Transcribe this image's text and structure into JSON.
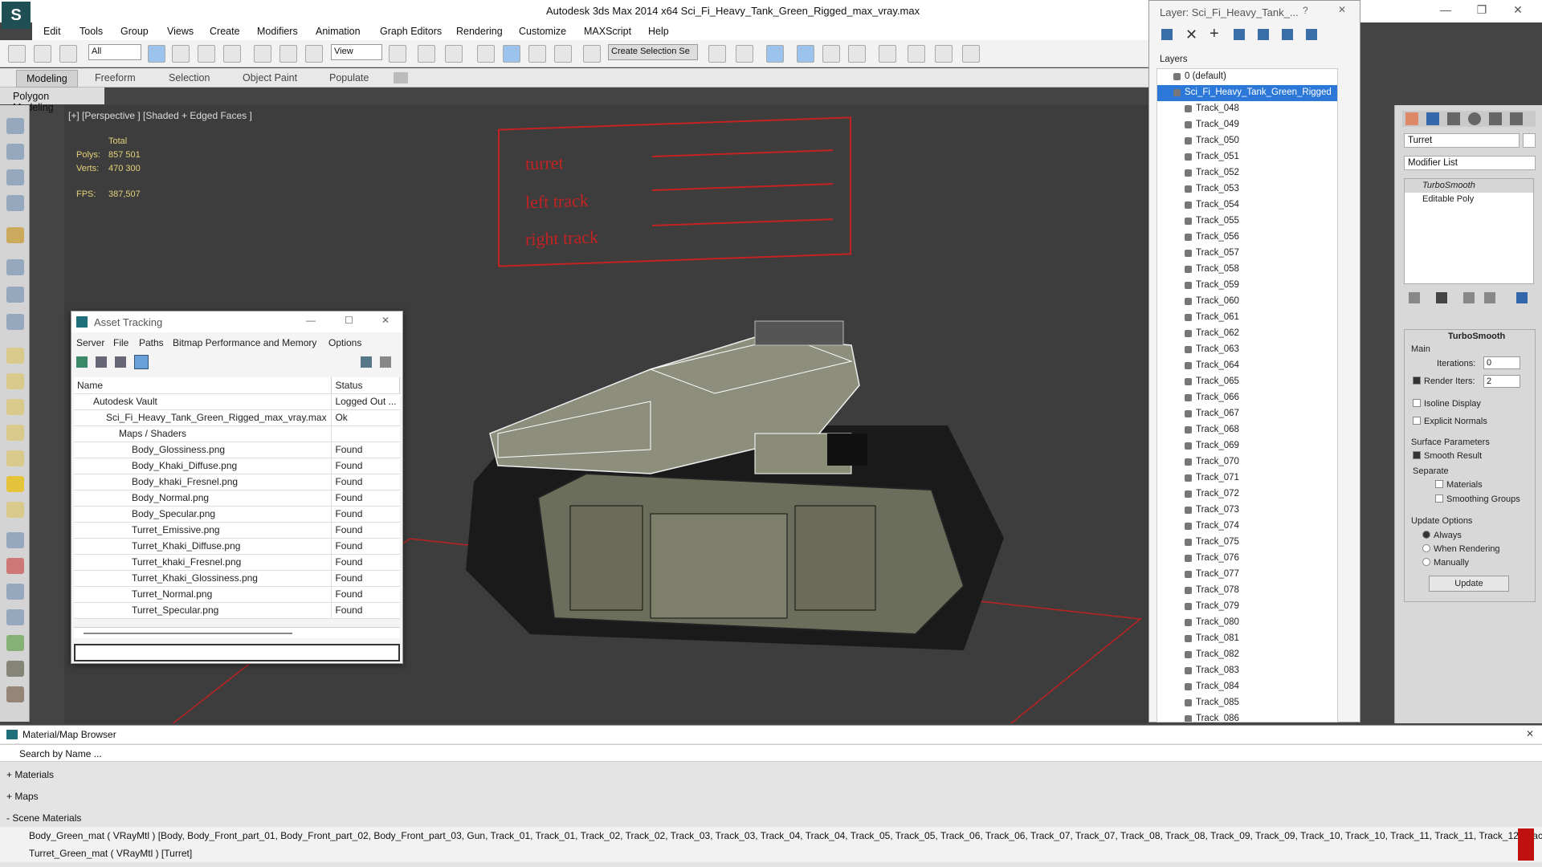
{
  "app": {
    "title": "Autodesk 3ds Max  2014 x64     Sci_Fi_Heavy_Tank_Green_Rigged_max_vray.max"
  },
  "menu": [
    "Edit",
    "Tools",
    "Group",
    "Views",
    "Create",
    "Modifiers",
    "Animation",
    "Graph Editors",
    "Rendering",
    "Customize",
    "MAXScript",
    "Help"
  ],
  "toolbar": {
    "filter": "All",
    "ref_coord": "View",
    "selection_set": "Create Selection Se"
  },
  "ribbon": {
    "tabs": [
      "Modeling",
      "Freeform",
      "Selection",
      "Object Paint",
      "Populate"
    ],
    "sub": "Polygon Modeling"
  },
  "viewport": {
    "label": "[+] [Perspective ] [Shaded + Edged Faces ]",
    "stats": {
      "total": "Total",
      "polys_label": "Polys:",
      "polys": "857 501",
      "verts_label": "Verts:",
      "verts": "470 300",
      "fps_label": "FPS:",
      "fps": "387,507"
    },
    "annotations": [
      "turret",
      "left track",
      "right track"
    ]
  },
  "asset_tracking": {
    "title": "Asset Tracking",
    "menu": [
      "Server",
      "File",
      "Paths",
      "Bitmap Performance and Memory",
      "Options"
    ],
    "columns": [
      "Name",
      "Status"
    ],
    "rows": [
      {
        "name": "Autodesk Vault",
        "status": "Logged Out ..."
      },
      {
        "name": "Sci_Fi_Heavy_Tank_Green_Rigged_max_vray.max",
        "status": "Ok"
      },
      {
        "name": "Maps / Shaders",
        "status": ""
      },
      {
        "name": "Body_Glossiness.png",
        "status": "Found"
      },
      {
        "name": "Body_Khaki_Diffuse.png",
        "status": "Found"
      },
      {
        "name": "Body_khaki_Fresnel.png",
        "status": "Found"
      },
      {
        "name": "Body_Normal.png",
        "status": "Found"
      },
      {
        "name": "Body_Specular.png",
        "status": "Found"
      },
      {
        "name": "Turret_Emissive.png",
        "status": "Found"
      },
      {
        "name": "Turret_Khaki_Diffuse.png",
        "status": "Found"
      },
      {
        "name": "Turret_khaki_Fresnel.png",
        "status": "Found"
      },
      {
        "name": "Turret_Khaki_Glossiness.png",
        "status": "Found"
      },
      {
        "name": "Turret_Normal.png",
        "status": "Found"
      },
      {
        "name": "Turret_Specular.png",
        "status": "Found"
      }
    ]
  },
  "layers": {
    "title": "Layer: Sci_Fi_Heavy_Tank_...",
    "header": "Layers",
    "items": [
      "0 (default)",
      "Sci_Fi_Heavy_Tank_Green_Rigged",
      "Track_048",
      "Track_049",
      "Track_050",
      "Track_051",
      "Track_052",
      "Track_053",
      "Track_054",
      "Track_055",
      "Track_056",
      "Track_057",
      "Track_058",
      "Track_059",
      "Track_060",
      "Track_061",
      "Track_062",
      "Track_063",
      "Track_064",
      "Track_065",
      "Track_066",
      "Track_067",
      "Track_068",
      "Track_069",
      "Track_070",
      "Track_071",
      "Track_072",
      "Track_073",
      "Track_074",
      "Track_075",
      "Track_076",
      "Track_077",
      "Track_078",
      "Track_079",
      "Track_080",
      "Track_081",
      "Track_082",
      "Track_083",
      "Track_084",
      "Track_085",
      "Track_086"
    ]
  },
  "command_panel": {
    "object_name": "Turret",
    "modifier_list": "Modifier List",
    "stack": [
      "TurboSmooth",
      "Editable Poly"
    ],
    "rollout": "TurboSmooth",
    "main": "Main",
    "iterations_label": "Iterations:",
    "iterations": "0",
    "render_iters_label": "Render Iters:",
    "render_iters": "2",
    "isoline": "Isoline Display",
    "explicit": "Explicit Normals",
    "surface": "Surface Parameters",
    "smooth_result": "Smooth Result",
    "separate": "Separate",
    "materials": "Materials",
    "smoothing": "Smoothing Groups",
    "update_options": "Update Options",
    "always": "Always",
    "when_rendering": "When Rendering",
    "manually": "Manually",
    "update": "Update"
  },
  "material_browser": {
    "title": "Material/Map Browser",
    "search": "Search by Name ...",
    "materials": "+ Materials",
    "maps": "+ Maps",
    "scene": "- Scene Materials",
    "scene_rows": [
      "Body_Green_mat  ( VRayMtl )  [Body, Body_Front_part_01, Body_Front_part_02, Body_Front_part_03, Gun, Track_01, Track_01, Track_02, Track_02, Track_03, Track_03, Track_04, Track_04, Track_05, Track_05, Track_06, Track_06, Track_07, Track_07, Track_08, Track_08, Track_09, Track_09, Track_10, Track_10, Track_11, Track_11, Track_12, Track_12, Track_...",
      "Turret_Green_mat  ( VRayMtl )  [Turret]"
    ]
  },
  "colors": {
    "accent": "#2b78d8",
    "annotation": "#c42222",
    "stats": "#e6d27a"
  }
}
